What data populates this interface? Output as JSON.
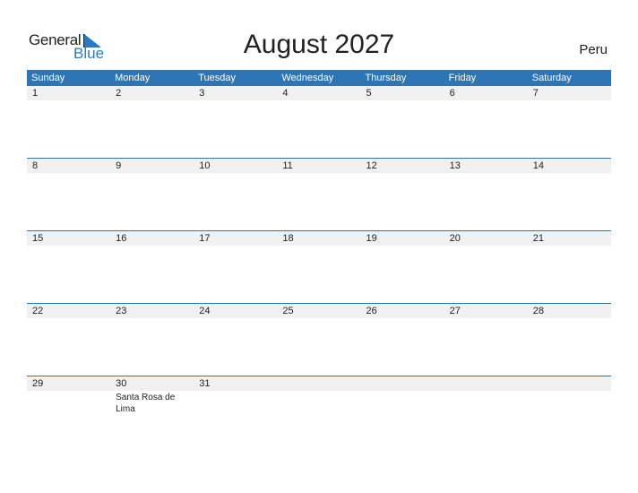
{
  "logo": {
    "word1": "General",
    "word2": "Blue"
  },
  "title": "August 2027",
  "country": "Peru",
  "colors": {
    "header_bg": "#2e75b6",
    "accent": "#2a7abf",
    "row_bg": "#f1f1f1"
  },
  "day_names": [
    "Sunday",
    "Monday",
    "Tuesday",
    "Wednesday",
    "Thursday",
    "Friday",
    "Saturday"
  ],
  "weeks": [
    [
      "1",
      "2",
      "3",
      "4",
      "5",
      "6",
      "7"
    ],
    [
      "8",
      "9",
      "10",
      "11",
      "12",
      "13",
      "14"
    ],
    [
      "15",
      "16",
      "17",
      "18",
      "19",
      "20",
      "21"
    ],
    [
      "22",
      "23",
      "24",
      "25",
      "26",
      "27",
      "28"
    ],
    [
      "29",
      "30",
      "31",
      "",
      "",
      "",
      ""
    ]
  ],
  "holidays": {
    "30": "Santa Rosa de Lima"
  }
}
